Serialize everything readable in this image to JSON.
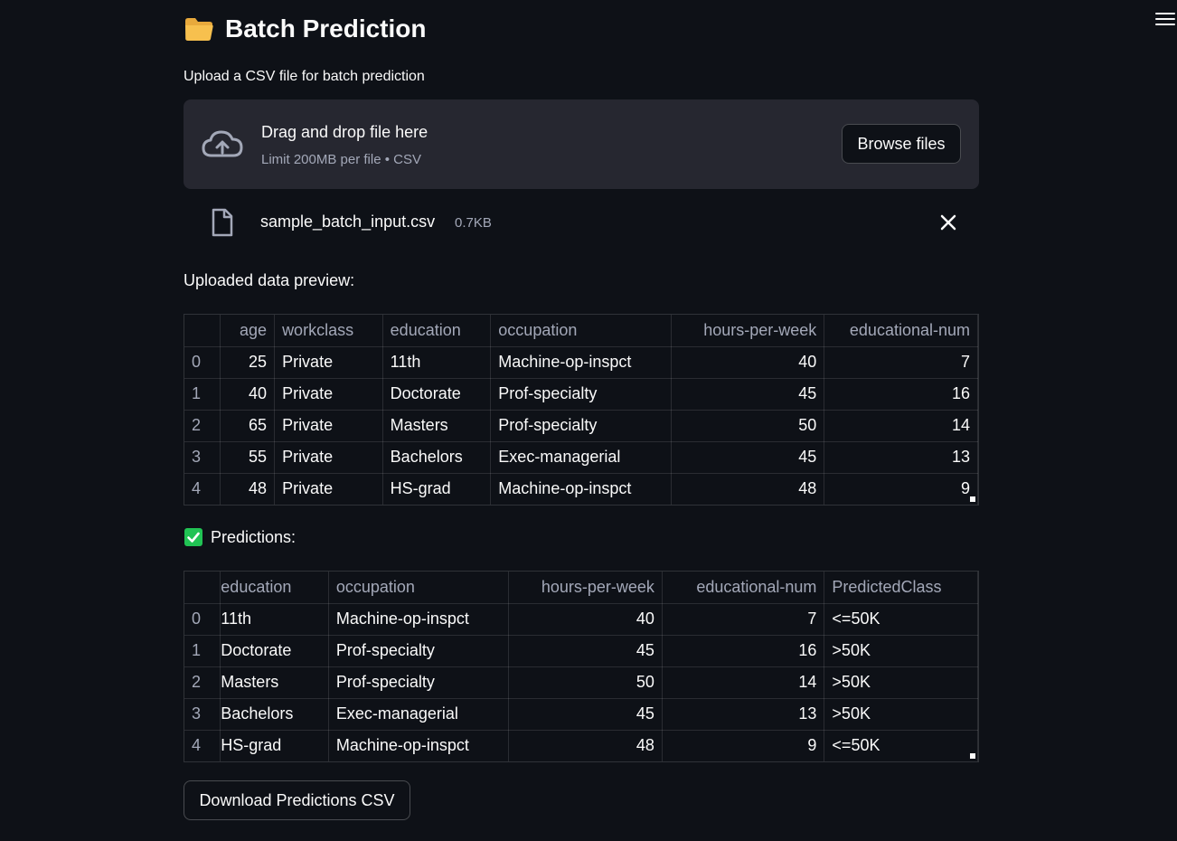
{
  "page": {
    "title": "Batch Prediction",
    "title_icon": "folder-icon"
  },
  "uploader": {
    "label": "Upload a CSV file for batch prediction",
    "drop_text": "Drag and drop file here",
    "limit_text": "Limit 200MB per file • CSV",
    "browse_label": "Browse files"
  },
  "uploaded_file": {
    "name": "sample_batch_input.csv",
    "size": "0.7KB"
  },
  "preview": {
    "label": "Uploaded data preview:",
    "columns": [
      "",
      "age",
      "workclass",
      "education",
      "occupation",
      "hours-per-week",
      "educational-num"
    ],
    "rows": [
      [
        "0",
        "25",
        "Private",
        "11th",
        "Machine-op-inspct",
        "40",
        "7"
      ],
      [
        "1",
        "40",
        "Private",
        "Doctorate",
        "Prof-specialty",
        "45",
        "16"
      ],
      [
        "2",
        "65",
        "Private",
        "Masters",
        "Prof-specialty",
        "50",
        "14"
      ],
      [
        "3",
        "55",
        "Private",
        "Bachelors",
        "Exec-managerial",
        "45",
        "13"
      ],
      [
        "4",
        "48",
        "Private",
        "HS-grad",
        "Machine-op-inspct",
        "48",
        "9"
      ]
    ]
  },
  "predictions": {
    "label": "Predictions:",
    "columns": [
      "",
      "education",
      "occupation",
      "hours-per-week",
      "educational-num",
      "PredictedClass"
    ],
    "rows": [
      [
        "0",
        "11th",
        "Machine-op-inspct",
        "40",
        "7",
        "<=50K"
      ],
      [
        "1",
        "Doctorate",
        "Prof-specialty",
        "45",
        "16",
        ">50K"
      ],
      [
        "2",
        "Masters",
        "Prof-specialty",
        "50",
        "14",
        ">50K"
      ],
      [
        "3",
        "Bachelors",
        "Exec-managerial",
        "45",
        "13",
        ">50K"
      ],
      [
        "4",
        "HS-grad",
        "Machine-op-inspct",
        "48",
        "9",
        "<=50K"
      ]
    ]
  },
  "download": {
    "label": "Download Predictions CSV"
  },
  "colors": {
    "background": "#0e1117",
    "surface": "#262730",
    "text": "#fafafa",
    "muted": "#a3a8b8",
    "success": "#21c354"
  }
}
